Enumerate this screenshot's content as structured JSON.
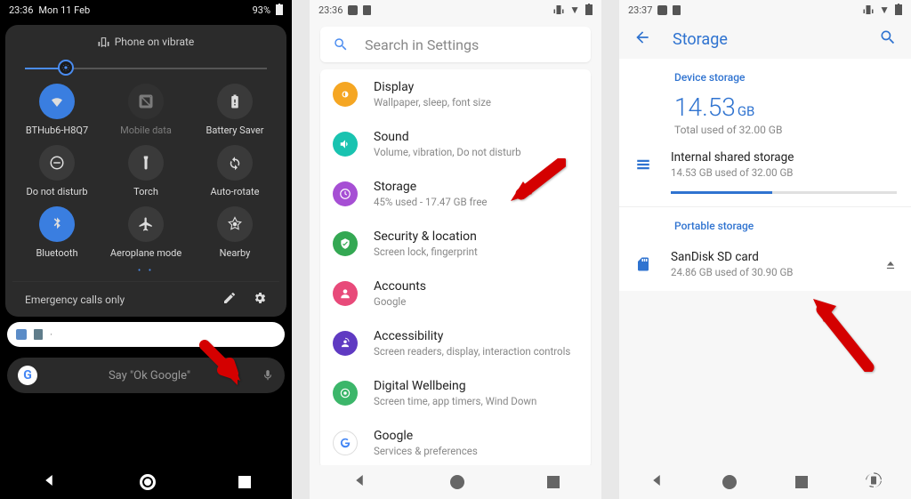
{
  "panel1": {
    "status": {
      "time": "23:36",
      "date": "Mon 11 Feb",
      "battery": "93%"
    },
    "vibe_label": "Phone on vibrate",
    "tiles": [
      {
        "label": "BTHub6-H8Q7",
        "on": true,
        "icon": "wifi"
      },
      {
        "label": "Mobile data",
        "on": false,
        "icon": "nosim",
        "disabled": true
      },
      {
        "label": "Battery Saver",
        "on": false,
        "icon": "battery"
      },
      {
        "label": "Do not disturb",
        "on": false,
        "icon": "dnd"
      },
      {
        "label": "Torch",
        "on": false,
        "icon": "torch"
      },
      {
        "label": "Auto-rotate",
        "on": false,
        "icon": "rotate"
      },
      {
        "label": "Bluetooth",
        "on": true,
        "icon": "bt"
      },
      {
        "label": "Aeroplane mode",
        "on": false,
        "icon": "plane"
      },
      {
        "label": "Nearby",
        "on": false,
        "icon": "nearby"
      }
    ],
    "footer": "Emergency calls only",
    "google_hint": "Say \"Ok Google\""
  },
  "panel2": {
    "status_time": "23:36",
    "search_placeholder": "Search in Settings",
    "rows": [
      {
        "title": "Display",
        "sub": "Wallpaper, sleep, font size",
        "color": "#f5a623"
      },
      {
        "title": "Sound",
        "sub": "Volume, vibration, Do not disturb",
        "color": "#19c3b0"
      },
      {
        "title": "Storage",
        "sub": "45% used - 17.47 GB free",
        "color": "#a64fd4"
      },
      {
        "title": "Security & location",
        "sub": "Screen lock, fingerprint",
        "color": "#34a853"
      },
      {
        "title": "Accounts",
        "sub": "Google",
        "color": "#e84a7a"
      },
      {
        "title": "Accessibility",
        "sub": "Screen readers, display, interaction controls",
        "color": "#5f3ac2"
      },
      {
        "title": "Digital Wellbeing",
        "sub": "Screen time, app timers, Wind Down",
        "color": "#3cb66a"
      },
      {
        "title": "Google",
        "sub": "Services & preferences",
        "color": "#ffffff"
      }
    ]
  },
  "panel3": {
    "status_time": "23:37",
    "title": "Storage",
    "device_label": "Device storage",
    "total_used": "14.53",
    "total_unit": "GB",
    "total_sub": "Total used of 32.00 GB",
    "internal_title": "Internal shared storage",
    "internal_sub": "14.53 GB used of 32.00 GB",
    "portable_label": "Portable storage",
    "sd_title": "SanDisk SD card",
    "sd_sub": "24.86 GB used of 30.90 GB"
  }
}
